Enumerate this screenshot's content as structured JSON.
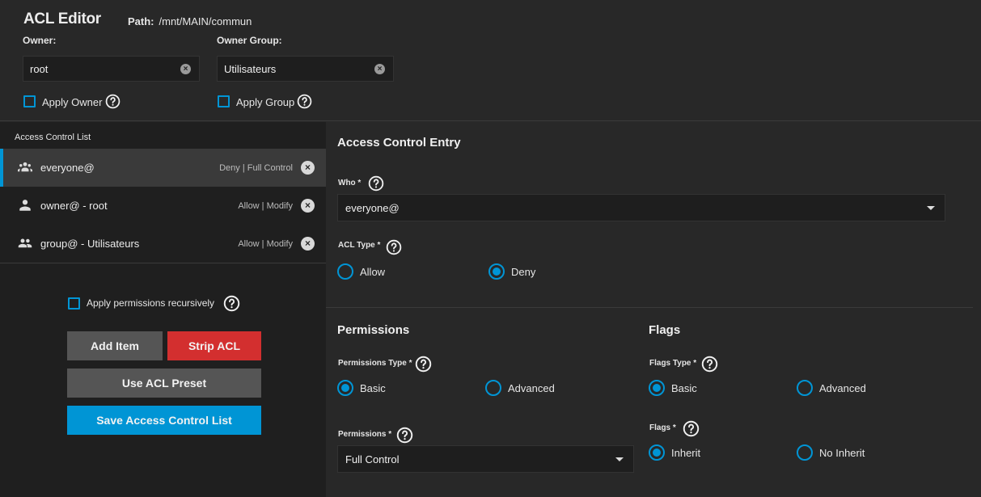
{
  "header": {
    "title": "ACL Editor",
    "path_label": "Path:",
    "path_value": "/mnt/MAIN/commun",
    "owner_label": "Owner:",
    "owner_value": "root",
    "owner_group_label": "Owner Group:",
    "owner_group_value": "Utilisateurs",
    "apply_owner_label": "Apply Owner",
    "apply_group_label": "Apply Group"
  },
  "acl_list": {
    "title": "Access Control List",
    "items": [
      {
        "name": "everyone@",
        "perm": "Deny | Full Control",
        "icon": "group-icon"
      },
      {
        "name": "owner@ - root",
        "perm": "Allow | Modify",
        "icon": "person-icon"
      },
      {
        "name": "group@ - Utilisateurs",
        "perm": "Allow | Modify",
        "icon": "group-icon"
      }
    ],
    "recursive_label": "Apply permissions recursively",
    "add_item": "Add Item",
    "strip_acl": "Strip ACL",
    "use_preset": "Use ACL Preset",
    "save": "Save Access Control List"
  },
  "entry": {
    "title": "Access Control Entry",
    "who_label": "Who *",
    "who_value": "everyone@",
    "acl_type_label": "ACL Type *",
    "acl_type_options": [
      "Allow",
      "Deny"
    ],
    "acl_type_selected": "Deny",
    "permissions_title": "Permissions",
    "permissions_type_label": "Permissions Type *",
    "permissions_type_options": [
      "Basic",
      "Advanced"
    ],
    "permissions_label": "Permissions *",
    "permissions_value": "Full Control",
    "flags_title": "Flags",
    "flags_type_label": "Flags Type *",
    "flags_type_options": [
      "Basic",
      "Advanced"
    ],
    "flags_label": "Flags *",
    "flags_options": [
      "Inherit",
      "No Inherit"
    ]
  },
  "colors": {
    "accent": "#0095d5",
    "danger": "#d32f2f",
    "secondary_button": "#555555"
  }
}
